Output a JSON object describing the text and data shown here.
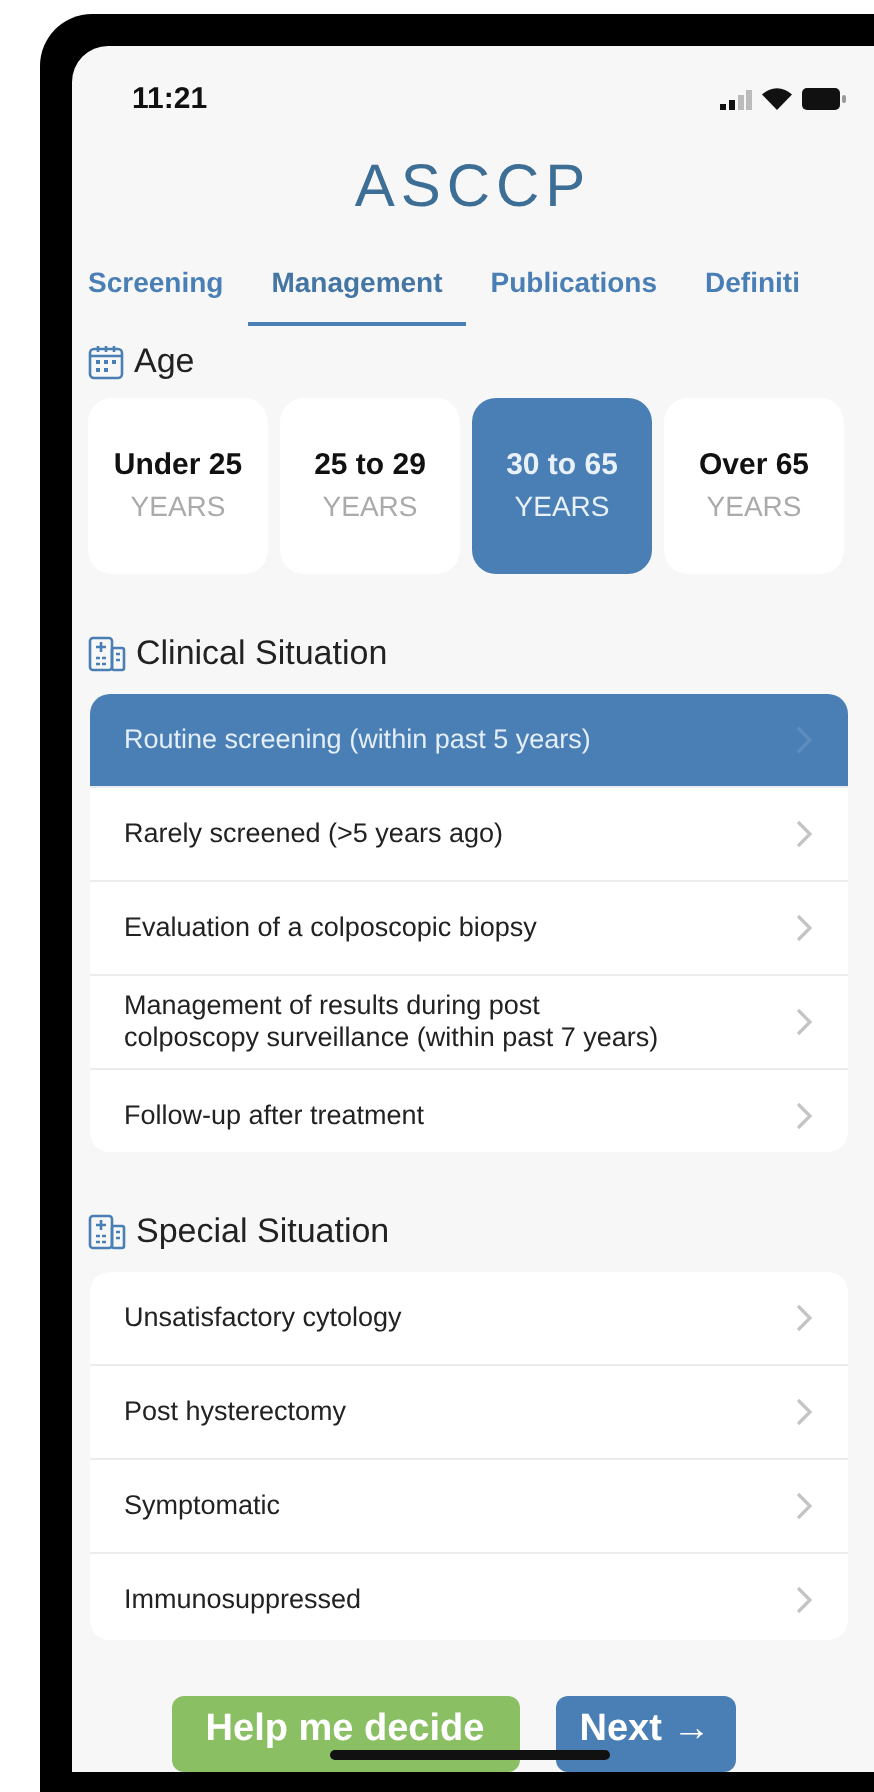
{
  "status_bar": {
    "time": "11:21"
  },
  "logo": "ASCCP",
  "tabs": [
    {
      "label": "Screening",
      "selected": false
    },
    {
      "label": "Management",
      "selected": true
    },
    {
      "label": "Publications",
      "selected": false
    },
    {
      "label": "Definiti",
      "selected": false
    }
  ],
  "age": {
    "title": "Age",
    "options": [
      {
        "label": "Under 25",
        "unit": "YEARS",
        "selected": false
      },
      {
        "label": "25 to 29",
        "unit": "YEARS",
        "selected": false
      },
      {
        "label": "30 to 65",
        "unit": "YEARS",
        "selected": true
      },
      {
        "label": "Over 65",
        "unit": "YEARS",
        "selected": false
      }
    ]
  },
  "clinical": {
    "title": "Clinical Situation",
    "items": [
      {
        "label": "Routine screening (within past 5 years)",
        "selected": true
      },
      {
        "label": "Rarely screened (>5 years ago)",
        "selected": false
      },
      {
        "label": "Evaluation of a colposcopic biopsy",
        "selected": false
      },
      {
        "label": "Management of results during post colposcopy surveillance (within past 7 years)",
        "selected": false
      },
      {
        "label": "Follow-up after treatment",
        "selected": false
      }
    ]
  },
  "special": {
    "title": "Special Situation",
    "items": [
      {
        "label": "Unsatisfactory cytology",
        "selected": false
      },
      {
        "label": "Post hysterectomy",
        "selected": false
      },
      {
        "label": "Symptomatic",
        "selected": false
      },
      {
        "label": "Immunosuppressed",
        "selected": false
      }
    ]
  },
  "buttons": [
    {
      "label": "Help me decide",
      "kind": "secondary"
    },
    {
      "label": "Next →",
      "kind": "primary"
    }
  ]
}
